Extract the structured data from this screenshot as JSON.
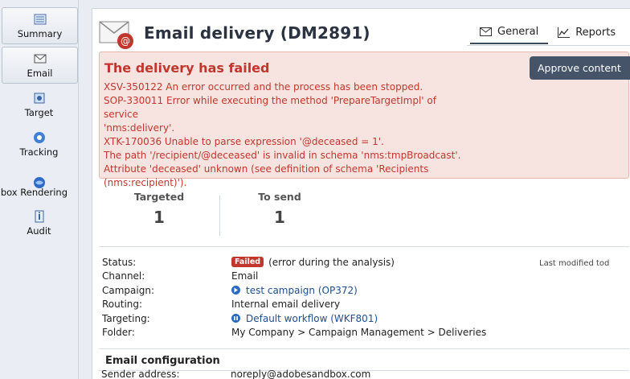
{
  "nav": {
    "items": [
      {
        "label": "Summary",
        "icon": "summary-icon"
      },
      {
        "label": "Email",
        "icon": "email-icon"
      },
      {
        "label": "Target",
        "icon": "target-icon"
      },
      {
        "label": "Tracking",
        "icon": "tracking-icon"
      },
      {
        "label": "Inbox Rendering",
        "icon": "inbox-rendering-icon"
      },
      {
        "label": "Audit",
        "icon": "audit-icon"
      }
    ]
  },
  "header": {
    "title": "Email delivery (DM2891)",
    "tabs": [
      {
        "label": "General",
        "icon": "envelope-icon"
      },
      {
        "label": "Reports",
        "icon": "chart-icon"
      }
    ]
  },
  "error": {
    "title": "The delivery has failed",
    "lines": [
      "XSV-350122 An error occurred and the process has been stopped.",
      "SOP-330011 Error while executing the method 'PrepareTargetImpl' of service",
      "'nms:delivery'.",
      "XTK-170036 Unable to parse expression '@deceased = 1'.",
      "The path '/recipient/@deceased' is invalid in schema 'nms:tmpBroadcast'.",
      "Attribute 'deceased' unknown (see definition of schema 'Recipients",
      "(nms:recipient)')."
    ],
    "approve_label": "Approve content"
  },
  "stats": {
    "targeted_label": "Targeted",
    "targeted_value": "1",
    "to_send_label": "To send",
    "to_send_value": "1"
  },
  "props": {
    "status_label": "Status:",
    "status_badge": "Failed",
    "status_text": "(error during the analysis)",
    "last_modified": "Last modified tod",
    "channel_label": "Channel:",
    "channel_value": "Email",
    "campaign_label": "Campaign:",
    "campaign_value": "test campaign (OP372)",
    "routing_label": "Routing:",
    "routing_value": "Internal email delivery",
    "targeting_label": "Targeting:",
    "targeting_value": "Default workflow (WKF801)",
    "folder_label": "Folder:",
    "folder_value": "My Company > Campaign Management > Deliveries"
  },
  "email_config": {
    "section_title": "Email configuration",
    "sender_label": "Sender address:",
    "sender_value": "noreply@adobesandbox.com"
  },
  "colors": {
    "error_text": "#c1372e",
    "error_bg": "#f7e4e0",
    "button_bg": "#455469",
    "link": "#1f4e8c"
  }
}
